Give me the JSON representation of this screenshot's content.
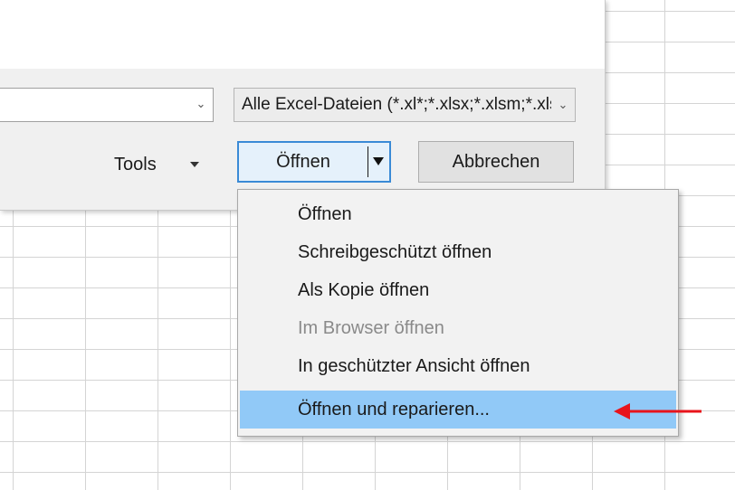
{
  "filetype_filter": {
    "value": "Alle Excel-Dateien (*.xl*;*.xlsx;*.xlsm;*.xlsb;*.xlam;*.xltx;*.xltm;*.xls;*.xlt)"
  },
  "toolbar": {
    "tools_label": "Tools",
    "open_label": "Öffnen",
    "cancel_label": "Abbrechen"
  },
  "open_menu": {
    "items": [
      {
        "label": "Öffnen",
        "state": "normal"
      },
      {
        "label": "Schreibgeschützt öffnen",
        "state": "normal"
      },
      {
        "label": "Als Kopie öffnen",
        "state": "normal"
      },
      {
        "label": "Im Browser öffnen",
        "state": "disabled"
      },
      {
        "label": "In geschützter Ansicht öffnen",
        "state": "normal"
      },
      {
        "label": "Öffnen und reparieren...",
        "state": "highlighted"
      }
    ]
  },
  "annotation": {
    "icon": "red-arrow-left-icon",
    "color": "#e8141b"
  },
  "colors": {
    "menu_highlight": "#91c9f7",
    "focus_border": "#3a8ad6"
  }
}
